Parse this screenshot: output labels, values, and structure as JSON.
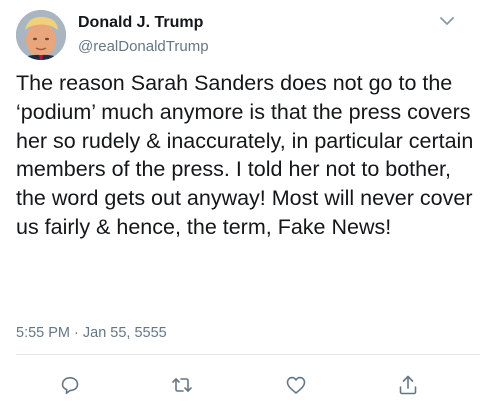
{
  "tweet": {
    "author_name": "Donald J. Trump",
    "author_handle": "@realDonaldTrump",
    "text": "The reason Sarah Sanders does not go to the ‘podium’ much anymore is that the press covers her so rudely & inaccurately, in particular certain members of the press. I told her not to bother, the word gets out anyway! Most will never cover us fairly & hence, the term, Fake News!",
    "timestamp": "5:55 PM · Jan 55, 5555"
  },
  "icons": {
    "menu": "chevron-down-icon",
    "reply": "reply-icon",
    "retweet": "retweet-icon",
    "like": "heart-icon",
    "share": "share-icon"
  },
  "colors": {
    "text": "#14171a",
    "secondary": "#657786",
    "icon": "#657786",
    "divider": "#e1e8ed"
  }
}
